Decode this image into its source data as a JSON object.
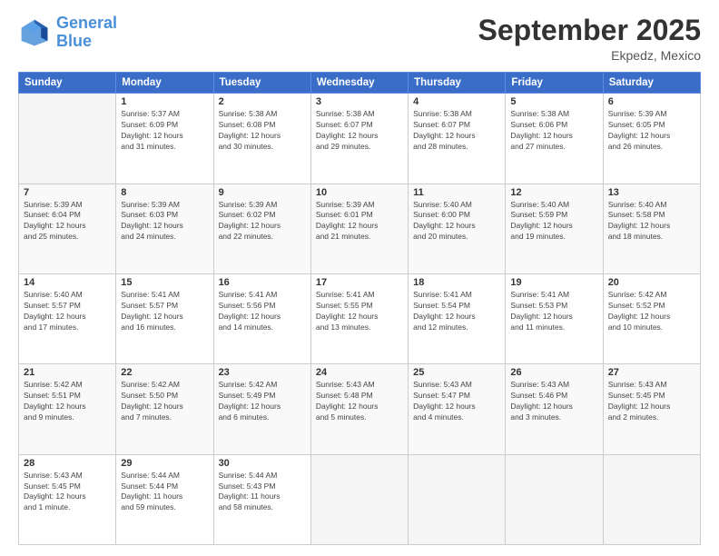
{
  "header": {
    "logo_line1": "General",
    "logo_line2": "Blue",
    "title": "September 2025",
    "subtitle": "Ekpedz, Mexico"
  },
  "weekdays": [
    "Sunday",
    "Monday",
    "Tuesday",
    "Wednesday",
    "Thursday",
    "Friday",
    "Saturday"
  ],
  "weeks": [
    [
      {
        "day": "",
        "info": ""
      },
      {
        "day": "1",
        "info": "Sunrise: 5:37 AM\nSunset: 6:09 PM\nDaylight: 12 hours\nand 31 minutes."
      },
      {
        "day": "2",
        "info": "Sunrise: 5:38 AM\nSunset: 6:08 PM\nDaylight: 12 hours\nand 30 minutes."
      },
      {
        "day": "3",
        "info": "Sunrise: 5:38 AM\nSunset: 6:07 PM\nDaylight: 12 hours\nand 29 minutes."
      },
      {
        "day": "4",
        "info": "Sunrise: 5:38 AM\nSunset: 6:07 PM\nDaylight: 12 hours\nand 28 minutes."
      },
      {
        "day": "5",
        "info": "Sunrise: 5:38 AM\nSunset: 6:06 PM\nDaylight: 12 hours\nand 27 minutes."
      },
      {
        "day": "6",
        "info": "Sunrise: 5:39 AM\nSunset: 6:05 PM\nDaylight: 12 hours\nand 26 minutes."
      }
    ],
    [
      {
        "day": "7",
        "info": "Sunrise: 5:39 AM\nSunset: 6:04 PM\nDaylight: 12 hours\nand 25 minutes."
      },
      {
        "day": "8",
        "info": "Sunrise: 5:39 AM\nSunset: 6:03 PM\nDaylight: 12 hours\nand 24 minutes."
      },
      {
        "day": "9",
        "info": "Sunrise: 5:39 AM\nSunset: 6:02 PM\nDaylight: 12 hours\nand 22 minutes."
      },
      {
        "day": "10",
        "info": "Sunrise: 5:39 AM\nSunset: 6:01 PM\nDaylight: 12 hours\nand 21 minutes."
      },
      {
        "day": "11",
        "info": "Sunrise: 5:40 AM\nSunset: 6:00 PM\nDaylight: 12 hours\nand 20 minutes."
      },
      {
        "day": "12",
        "info": "Sunrise: 5:40 AM\nSunset: 5:59 PM\nDaylight: 12 hours\nand 19 minutes."
      },
      {
        "day": "13",
        "info": "Sunrise: 5:40 AM\nSunset: 5:58 PM\nDaylight: 12 hours\nand 18 minutes."
      }
    ],
    [
      {
        "day": "14",
        "info": "Sunrise: 5:40 AM\nSunset: 5:57 PM\nDaylight: 12 hours\nand 17 minutes."
      },
      {
        "day": "15",
        "info": "Sunrise: 5:41 AM\nSunset: 5:57 PM\nDaylight: 12 hours\nand 16 minutes."
      },
      {
        "day": "16",
        "info": "Sunrise: 5:41 AM\nSunset: 5:56 PM\nDaylight: 12 hours\nand 14 minutes."
      },
      {
        "day": "17",
        "info": "Sunrise: 5:41 AM\nSunset: 5:55 PM\nDaylight: 12 hours\nand 13 minutes."
      },
      {
        "day": "18",
        "info": "Sunrise: 5:41 AM\nSunset: 5:54 PM\nDaylight: 12 hours\nand 12 minutes."
      },
      {
        "day": "19",
        "info": "Sunrise: 5:41 AM\nSunset: 5:53 PM\nDaylight: 12 hours\nand 11 minutes."
      },
      {
        "day": "20",
        "info": "Sunrise: 5:42 AM\nSunset: 5:52 PM\nDaylight: 12 hours\nand 10 minutes."
      }
    ],
    [
      {
        "day": "21",
        "info": "Sunrise: 5:42 AM\nSunset: 5:51 PM\nDaylight: 12 hours\nand 9 minutes."
      },
      {
        "day": "22",
        "info": "Sunrise: 5:42 AM\nSunset: 5:50 PM\nDaylight: 12 hours\nand 7 minutes."
      },
      {
        "day": "23",
        "info": "Sunrise: 5:42 AM\nSunset: 5:49 PM\nDaylight: 12 hours\nand 6 minutes."
      },
      {
        "day": "24",
        "info": "Sunrise: 5:43 AM\nSunset: 5:48 PM\nDaylight: 12 hours\nand 5 minutes."
      },
      {
        "day": "25",
        "info": "Sunrise: 5:43 AM\nSunset: 5:47 PM\nDaylight: 12 hours\nand 4 minutes."
      },
      {
        "day": "26",
        "info": "Sunrise: 5:43 AM\nSunset: 5:46 PM\nDaylight: 12 hours\nand 3 minutes."
      },
      {
        "day": "27",
        "info": "Sunrise: 5:43 AM\nSunset: 5:45 PM\nDaylight: 12 hours\nand 2 minutes."
      }
    ],
    [
      {
        "day": "28",
        "info": "Sunrise: 5:43 AM\nSunset: 5:45 PM\nDaylight: 12 hours\nand 1 minute."
      },
      {
        "day": "29",
        "info": "Sunrise: 5:44 AM\nSunset: 5:44 PM\nDaylight: 11 hours\nand 59 minutes."
      },
      {
        "day": "30",
        "info": "Sunrise: 5:44 AM\nSunset: 5:43 PM\nDaylight: 11 hours\nand 58 minutes."
      },
      {
        "day": "",
        "info": ""
      },
      {
        "day": "",
        "info": ""
      },
      {
        "day": "",
        "info": ""
      },
      {
        "day": "",
        "info": ""
      }
    ]
  ]
}
